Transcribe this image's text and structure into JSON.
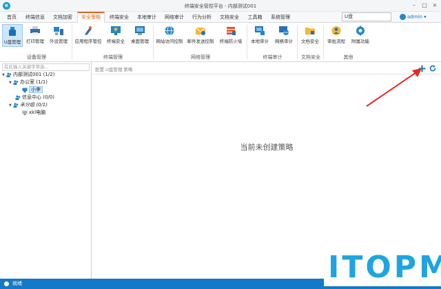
{
  "window": {
    "title": "终端安全管控平台 - 内部测试001"
  },
  "menu": {
    "tabs": [
      {
        "label": "首页"
      },
      {
        "label": "终端信息"
      },
      {
        "label": "文档加密"
      },
      {
        "label": "安全策略"
      },
      {
        "label": "终端安全"
      },
      {
        "label": "本地审计"
      },
      {
        "label": "网络审计"
      },
      {
        "label": "行为分析"
      },
      {
        "label": "文档安全"
      },
      {
        "label": "工具箱"
      },
      {
        "label": "系统管理"
      }
    ],
    "active_tab": "安全策略",
    "search_value": "U盘",
    "user": "admin"
  },
  "ribbon": {
    "buttons": [
      {
        "label": "U盘管理"
      },
      {
        "label": "打印管理"
      },
      {
        "label": "外设管理"
      },
      {
        "label": "应用程序管控"
      },
      {
        "label": "终端安全"
      },
      {
        "label": "桌面管理"
      },
      {
        "label": "网站访问控制"
      },
      {
        "label": "邮件发送控制"
      },
      {
        "label": "终端防火墙"
      },
      {
        "label": "本地审计"
      },
      {
        "label": "网络审计"
      },
      {
        "label": "文档安全"
      },
      {
        "label": "审批流程"
      },
      {
        "label": "附属功能"
      }
    ],
    "groups": [
      {
        "label": "设备管理"
      },
      {
        "label": "终端管理"
      },
      {
        "label": "网络管理"
      },
      {
        "label": "终端审计"
      },
      {
        "label": "文档安全"
      },
      {
        "label": "其他"
      }
    ]
  },
  "tree": {
    "search_placeholder": "在此输入关键字筛选...",
    "nodes": [
      {
        "label": "内部测试001 (1/2)"
      },
      {
        "label": "办公室 (1/1)"
      },
      {
        "label": "小李"
      },
      {
        "label": "信息中心 (0/0)"
      },
      {
        "label": "未分组 (0/1)"
      },
      {
        "label": "xkl电脑"
      }
    ]
  },
  "content": {
    "breadcrumb": "配置 U盘管理 策略",
    "empty_message": "当前未创建策略"
  },
  "status": {
    "text": "就绪"
  },
  "watermark": {
    "text": "ITOPM"
  },
  "colors": {
    "accent": "#e8641e",
    "primary": "#1379c8",
    "selected": "#cfe6fb"
  }
}
